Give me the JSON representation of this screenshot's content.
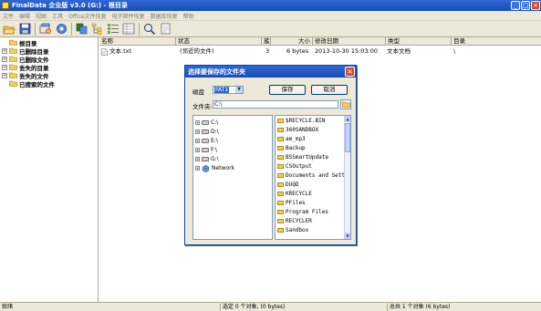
{
  "window": {
    "title": "FinalData 企业版 v3.0 (G:) - 根目录",
    "min_glyph": "_",
    "max_glyph": "□",
    "close_glyph": "×"
  },
  "menu": [
    {
      "label": "文件"
    },
    {
      "label": "编辑"
    },
    {
      "label": "视图"
    },
    {
      "label": "工具"
    },
    {
      "label": "Office文件恢复"
    },
    {
      "label": "电子邮件恢复"
    },
    {
      "label": "数据库恢复"
    },
    {
      "label": "帮助"
    }
  ],
  "toolbar": [
    {
      "icon": "open-folder-icon"
    },
    {
      "icon": "save-icon"
    },
    {
      "icon": "scan-icon"
    },
    {
      "icon": "settings-icon"
    },
    {
      "icon": "copy-icon"
    },
    {
      "icon": "tree-view-icon"
    },
    {
      "icon": "list-view-icon"
    },
    {
      "icon": "details-view-icon"
    },
    {
      "icon": "find-icon"
    },
    {
      "icon": "file-viewer-icon"
    }
  ],
  "tree": [
    {
      "label": "根目录",
      "expander": "",
      "selected": true
    },
    {
      "label": "已删除目录",
      "expander": "+"
    },
    {
      "label": "已删除文件",
      "expander": "+"
    },
    {
      "label": "丢失的目录",
      "expander": "+"
    },
    {
      "label": "丢失的文件",
      "expander": "+"
    },
    {
      "label": "已搜索的文件",
      "expander": ""
    }
  ],
  "list": {
    "columns": [
      "名称",
      "状态",
      "簇",
      "大小",
      "修改日期",
      "类型",
      "目录"
    ],
    "rows": [
      {
        "name": "文本.txt",
        "status": "(邻近的文件)",
        "cluster": "3",
        "size": "6 bytes",
        "modified": "2013-10-30 15:03:00",
        "type": "文本文档",
        "dir": "\\"
      }
    ]
  },
  "status": {
    "ready": "就绪",
    "selected": "选定 0 个对象, (0 bytes)",
    "total": "总共 1 个对象 (6 bytes)"
  },
  "dialog": {
    "title": "选择要保存的文件夹",
    "close_glyph": "×",
    "disk_label": "磁盘",
    "disk_value": "FAT1",
    "save_button": "保存",
    "cancel_button": "取消",
    "folder_label": "文件夹:",
    "folder_path": "C:\\",
    "drives": [
      {
        "label": "C:\\",
        "expander": "+"
      },
      {
        "label": "D:\\",
        "expander": "+"
      },
      {
        "label": "E:\\",
        "expander": "+"
      },
      {
        "label": "F:\\",
        "expander": "+"
      },
      {
        "label": "G:\\",
        "expander": "+"
      },
      {
        "label": "Network",
        "expander": "+"
      }
    ],
    "folders": [
      "$RECYCLE.BIN",
      "360SANDBOX",
      "am_mp3",
      "Backup",
      "BSSmartUpdate",
      "CSOutput",
      "Documents and Setti",
      "DUQD",
      "KRECYCLE",
      "PFiles",
      "Program Files",
      "RECYCLER",
      "Sandbox"
    ]
  }
}
